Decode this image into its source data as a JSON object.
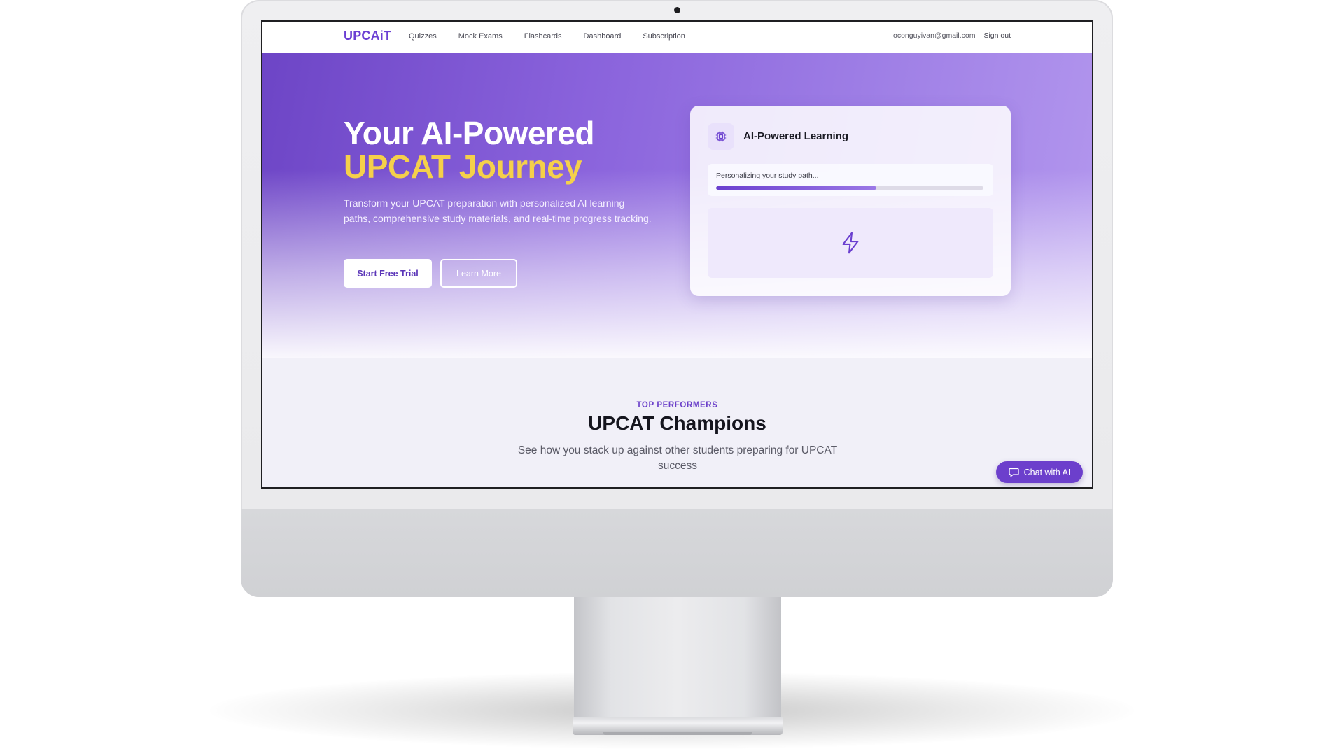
{
  "nav": {
    "brand": "UPCAiT",
    "links": [
      "Quizzes",
      "Mock Exams",
      "Flashcards",
      "Dashboard",
      "Subscription"
    ],
    "email": "oconguyivan@gmail.com",
    "signout": "Sign out"
  },
  "hero": {
    "title_line1": "Your AI-Powered",
    "title_line2": "UPCAT Journey",
    "subtitle": "Transform your UPCAT preparation with personalized AI learning paths, comprehensive study materials, and real-time progress tracking.",
    "primary_button": "Start Free Trial",
    "secondary_button": "Learn More"
  },
  "card": {
    "icon": "cpu-chip-icon",
    "title": "AI-Powered Learning",
    "progress_label": "Personalizing your study path...",
    "progress_fraction": 0.6,
    "feature_icon": "lightning-bolt-icon"
  },
  "section": {
    "eyebrow": "TOP PERFORMERS",
    "title": "UPCAT Champions",
    "subtitle": "See how you stack up against other students preparing for UPCAT success"
  },
  "chat": {
    "label": "Chat with AI",
    "icon": "chat-bubble-icon"
  },
  "colors": {
    "brand_purple": "#6b3fd3",
    "accent_yellow": "#f5d04a",
    "chat_button": "#6c3fcc"
  }
}
